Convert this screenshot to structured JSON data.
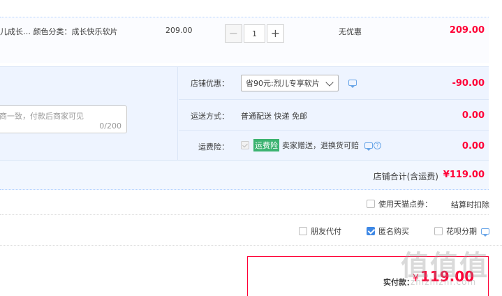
{
  "item": {
    "description": "儿成长…   颜色分类：成长快乐软片",
    "price": "209.00",
    "quantity": "1",
    "minus_symbol": "−",
    "plus_symbol": "+",
    "discount": "无优惠",
    "total": "209.00"
  },
  "message": {
    "placeholder": "商一致，付款后商家可见",
    "counter": "0/200"
  },
  "shop_options": {
    "discount_label": "店铺优惠：",
    "discount_selected": "省90元:烈儿专享软片",
    "discount_value": "-90.00",
    "shipping_label": "运送方式：",
    "shipping_text": "普通配送 快递 免邮",
    "shipping_value": "0.00",
    "insurance_label": "运费险：",
    "insurance_badge": "运费险",
    "insurance_text": "卖家赠送，退换货可赔",
    "insurance_value": "0.00"
  },
  "shop_total": {
    "label": "店铺合计(含运费)",
    "value": "¥119.00"
  },
  "coupon": {
    "label": "使用天猫点券：",
    "note": "结算时扣除"
  },
  "pay_options": [
    {
      "label": "朋友代付",
      "checked": false
    },
    {
      "label": "匿名购买",
      "checked": true
    },
    {
      "label": "花呗分期",
      "checked": false
    }
  ],
  "payment": {
    "label": "实付款：",
    "currency": "¥",
    "amount": "119.00"
  },
  "watermark": {
    "logo": "值值值",
    "url": "zhizhizhi.com"
  },
  "icons": {
    "chat": "chat-bubble-icon",
    "help": "help-icon"
  },
  "colors": {
    "price_red": "#ff0036",
    "accent_blue": "#3e88e5",
    "badge_green": "#3cb371"
  }
}
